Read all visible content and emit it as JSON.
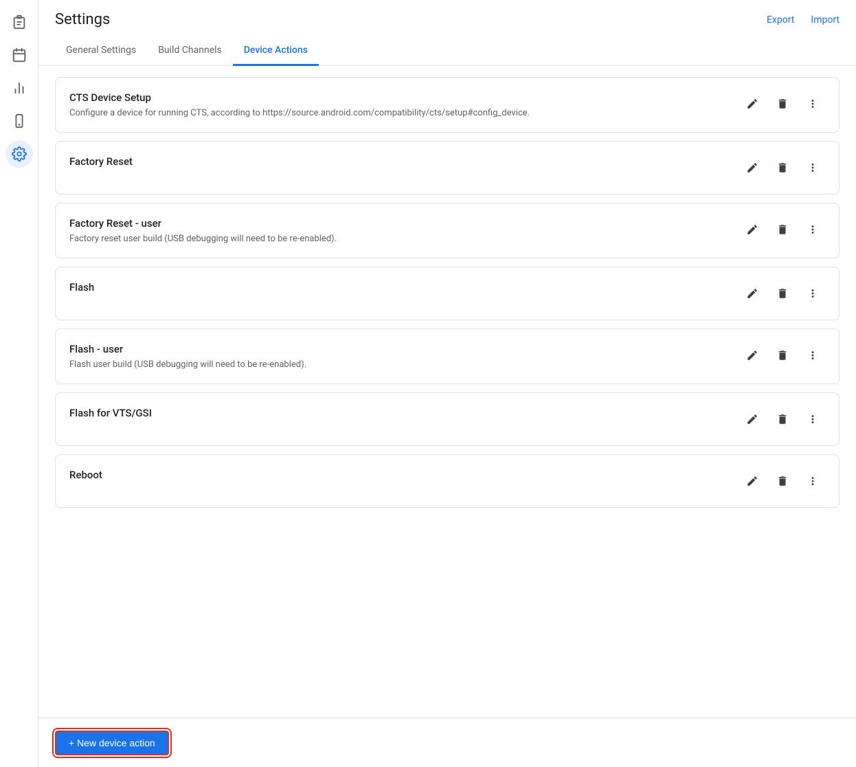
{
  "header": {
    "title": "Settings",
    "export_label": "Export",
    "import_label": "Import"
  },
  "tabs": [
    {
      "id": "general",
      "label": "General Settings",
      "active": false
    },
    {
      "id": "build-channels",
      "label": "Build Channels",
      "active": false
    },
    {
      "id": "device-actions",
      "label": "Device Actions",
      "active": true
    }
  ],
  "actions": [
    {
      "id": "cts-device-setup",
      "title": "CTS Device Setup",
      "description": "Configure a device for running CTS, according to https://source.android.com/compatibility/cts/setup#config_device."
    },
    {
      "id": "factory-reset",
      "title": "Factory Reset",
      "description": ""
    },
    {
      "id": "factory-reset-user",
      "title": "Factory Reset - user",
      "description": "Factory reset user build (USB debugging will need to be re-enabled)."
    },
    {
      "id": "flash",
      "title": "Flash",
      "description": ""
    },
    {
      "id": "flash-user",
      "title": "Flash - user",
      "description": "Flash user build (USB debugging will need to be re-enabled)."
    },
    {
      "id": "flash-vts-gsi",
      "title": "Flash for VTS/GSI",
      "description": ""
    },
    {
      "id": "reboot",
      "title": "Reboot",
      "description": ""
    }
  ],
  "bottom": {
    "new_action_label": "+ New device action"
  },
  "sidebar": {
    "items": [
      {
        "id": "clipboard",
        "icon": "📋",
        "active": false
      },
      {
        "id": "calendar",
        "icon": "📅",
        "active": false
      },
      {
        "id": "chart",
        "icon": "📊",
        "active": false
      },
      {
        "id": "device",
        "icon": "📱",
        "active": false
      },
      {
        "id": "settings",
        "icon": "⚙️",
        "active": true
      }
    ]
  }
}
